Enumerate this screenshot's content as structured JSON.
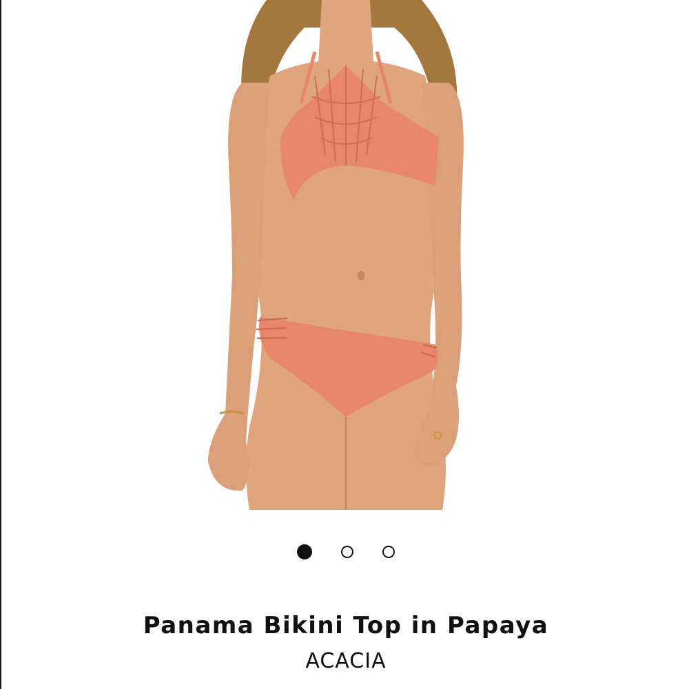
{
  "product": {
    "title": "Panama Bikini Top in Papaya",
    "brand": "ACACIA",
    "image": {
      "subject": "model-wearing-bikini",
      "swimsuit_color": "#e8866c",
      "skin_color": "#e0a57c",
      "hair_color": "#a4773f",
      "background_color": "#ffffff"
    }
  },
  "carousel": {
    "total_slides": 3,
    "active_index": 0,
    "active_color": "#111111",
    "inactive_color": "#ffffff"
  }
}
